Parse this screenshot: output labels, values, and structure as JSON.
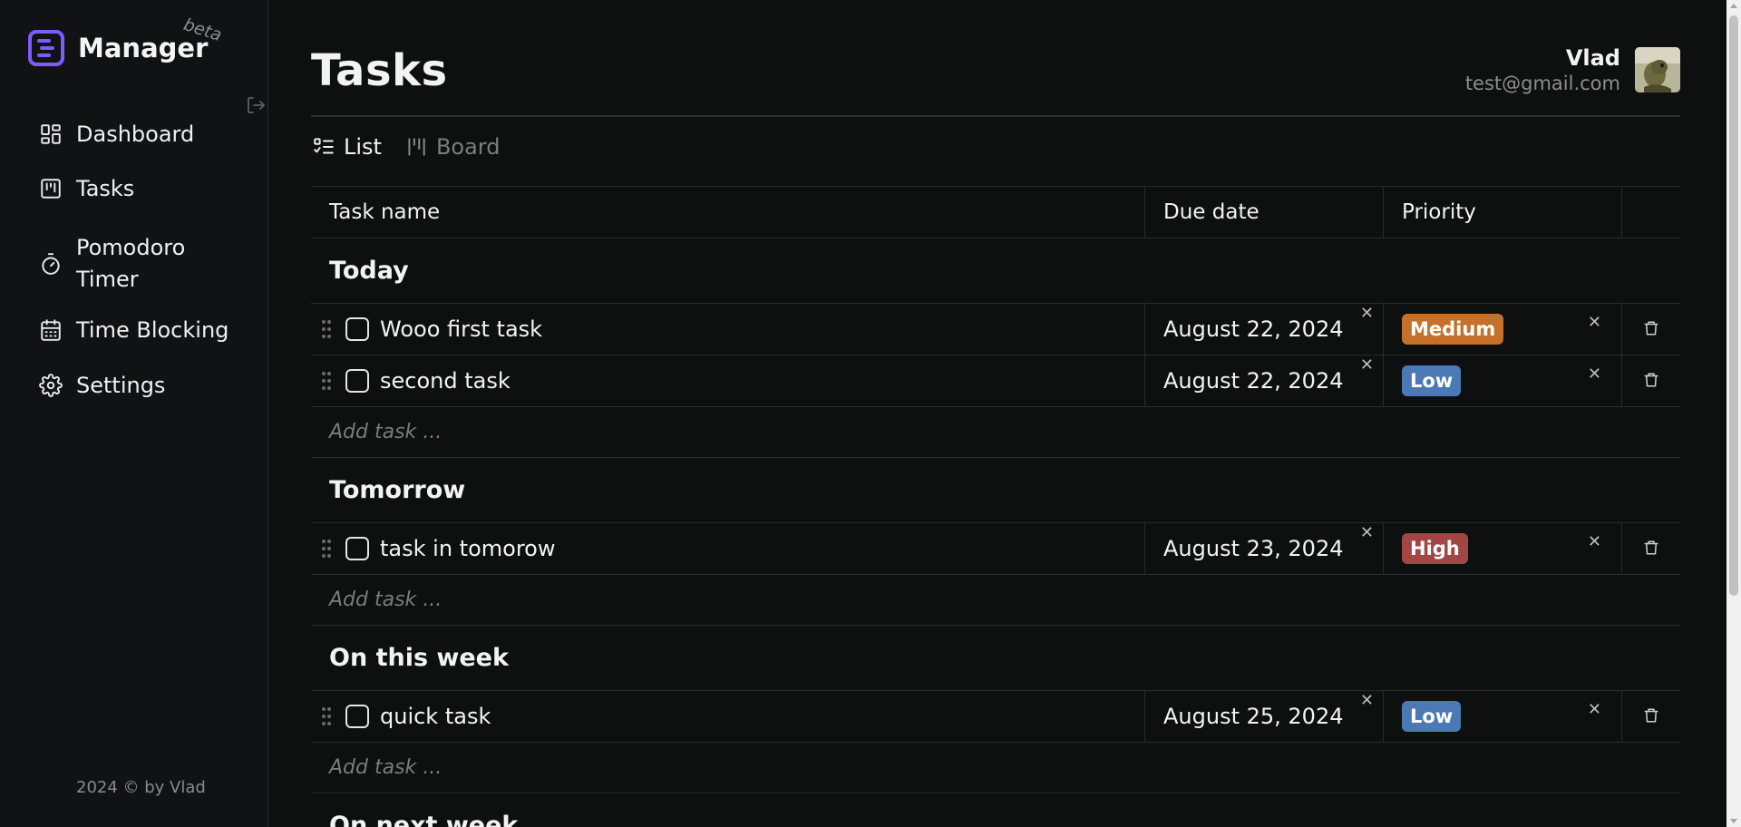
{
  "app": {
    "name": "Manager",
    "beta_label": "beta",
    "footer": "2024 © by Vlad",
    "accent_color": "#7c5cff"
  },
  "sidebar": {
    "items": [
      {
        "label": "Dashboard",
        "icon": "dashboard-icon"
      },
      {
        "label": "Tasks",
        "icon": "kanban-icon"
      },
      {
        "label": "Pomodoro Timer",
        "icon": "timer-icon"
      },
      {
        "label": "Time Blocking",
        "icon": "calendar-icon"
      },
      {
        "label": "Settings",
        "icon": "gear-icon"
      }
    ]
  },
  "header": {
    "title": "Tasks",
    "user_name": "Vlad",
    "user_email": "test@gmail.com"
  },
  "view_tabs": [
    {
      "label": "List",
      "icon": "list-check-icon",
      "active": true
    },
    {
      "label": "Board",
      "icon": "board-columns-icon",
      "active": false
    }
  ],
  "table": {
    "columns": [
      "Task name",
      "Due date",
      "Priority"
    ],
    "add_placeholder": "Add task ...",
    "groups": [
      {
        "title": "Today",
        "tasks": [
          {
            "name": "Wooo first task",
            "due": "August 22, 2024",
            "priority": "Medium"
          },
          {
            "name": "second task",
            "due": "August 22, 2024",
            "priority": "Low"
          }
        ]
      },
      {
        "title": "Tomorrow",
        "tasks": [
          {
            "name": "task in tomorow",
            "due": "August 23, 2024",
            "priority": "High"
          }
        ]
      },
      {
        "title": "On this week",
        "tasks": [
          {
            "name": "quick task",
            "due": "August 25, 2024",
            "priority": "Low"
          }
        ]
      },
      {
        "title": "On next week",
        "tasks": []
      }
    ]
  },
  "priority_colors": {
    "Medium": "#c5712c",
    "Low": "#4a79b6",
    "High": "#a24545"
  }
}
